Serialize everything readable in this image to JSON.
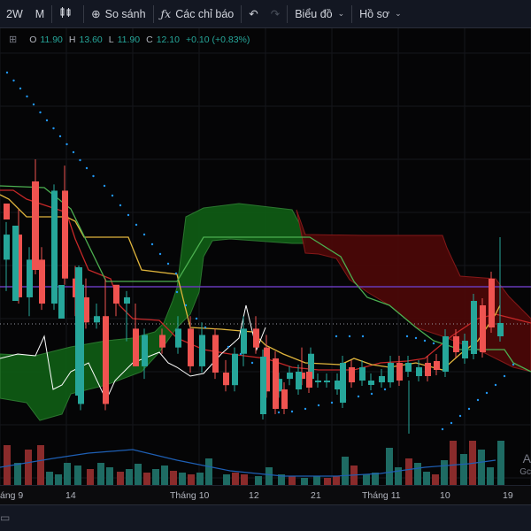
{
  "toolbar": {
    "interval_label": "2W",
    "interval_label2": "M",
    "compare_label": "So sánh",
    "indicators_label": "Các chỉ báo",
    "chart_label": "Biểu đồ",
    "profile_label": "Hồ sơ",
    "undo_icon": "undo-icon",
    "redo_icon": "redo-icon"
  },
  "legend": {
    "o_label": "O",
    "o_value": "11.90",
    "h_label": "H",
    "h_value": "13.60",
    "l_label": "L",
    "l_value": "11.90",
    "c_label": "C",
    "c_value": "12.10",
    "change": "+0.10 (+0.83%)"
  },
  "time_axis": {
    "labels": [
      "áng 9",
      "14",
      "Tháng 10",
      "12",
      "21",
      "Tháng 11",
      "10",
      "19"
    ]
  },
  "side_labels": {
    "a": "A",
    "go": "Gc"
  },
  "colors": {
    "up": "#26a69a",
    "down": "#ef5350",
    "kumo_bull": "#1b5e20",
    "kumo_bear": "#5d0a0a",
    "conversion": "#e0b53c",
    "base": "#b71c1c",
    "lagging": "#4caf50",
    "psar": "#2196f3",
    "trend_line": "#673ab7",
    "price_line": "#ffffff"
  },
  "chart_data": {
    "type": "candlestick",
    "candles": [
      {
        "o": 11.7,
        "h": 12.3,
        "l": 11.2,
        "c": 12.1
      },
      {
        "o": 12.1,
        "h": 12.5,
        "l": 11.0,
        "c": 11.1
      },
      {
        "o": 11.1,
        "h": 11.9,
        "l": 10.8,
        "c": 11.7
      },
      {
        "o": 11.7,
        "h": 11.9,
        "l": 10.9,
        "c": 11.0
      },
      {
        "o": 11.0,
        "h": 12.9,
        "l": 10.9,
        "c": 12.8
      },
      {
        "o": 12.8,
        "h": 13.2,
        "l": 11.3,
        "c": 11.4
      },
      {
        "o": 11.4,
        "h": 11.6,
        "l": 10.8,
        "c": 11.1
      },
      {
        "o": 11.1,
        "h": 11.4,
        "l": 10.6,
        "c": 10.7
      },
      {
        "o": 10.7,
        "h": 11.0,
        "l": 10.6,
        "c": 10.8
      },
      {
        "o": 10.8,
        "h": 11.4,
        "l": 9.3,
        "c": 9.4
      },
      {
        "o": 9.4,
        "h": 11.4,
        "l": 9.3,
        "c": 11.3
      },
      {
        "o": 11.3,
        "h": 11.1,
        "l": 10.8,
        "c": 11.0
      },
      {
        "o": 11.0,
        "h": 11.2,
        "l": 10.4,
        "c": 11.1
      },
      {
        "o": 10.6,
        "h": 11.0,
        "l": 10.0,
        "c": 10.0
      },
      {
        "o": 10.0,
        "h": 10.6,
        "l": 9.8,
        "c": 10.5
      },
      {
        "o": 10.5,
        "h": 10.6,
        "l": 10.2,
        "c": 10.3
      },
      {
        "o": 10.3,
        "h": 10.8,
        "l": 10.2,
        "c": 10.6
      },
      {
        "o": 10.6,
        "h": 10.8,
        "l": 9.9,
        "c": 10.0
      },
      {
        "o": 10.0,
        "h": 10.7,
        "l": 9.9,
        "c": 10.5
      },
      {
        "o": 10.5,
        "h": 10.6,
        "l": 9.8,
        "c": 9.9
      },
      {
        "o": 9.9,
        "h": 10.1,
        "l": 9.6,
        "c": 9.7
      },
      {
        "o": 9.7,
        "h": 10.3,
        "l": 9.6,
        "c": 10.2
      },
      {
        "o": 10.2,
        "h": 10.8,
        "l": 10.0,
        "c": 10.6
      },
      {
        "o": 10.6,
        "h": 10.8,
        "l": 10.2,
        "c": 10.3
      },
      {
        "o": 10.3,
        "h": 10.5,
        "l": 9.5,
        "c": 9.6
      },
      {
        "o": 9.6,
        "h": 9.9,
        "l": 9.5,
        "c": 9.8
      },
      {
        "o": 9.8,
        "h": 10.0,
        "l": 9.7,
        "c": 9.9
      },
      {
        "o": 9.9,
        "h": 10.3,
        "l": 9.7,
        "c": 9.8
      },
      {
        "o": 9.8,
        "h": 10.3,
        "l": 9.7,
        "c": 10.2
      }
    ],
    "note": "Ichimoku cloud with parabolic SAR dots; values approximated visually",
    "ylim": [
      9.0,
      13.5
    ]
  }
}
